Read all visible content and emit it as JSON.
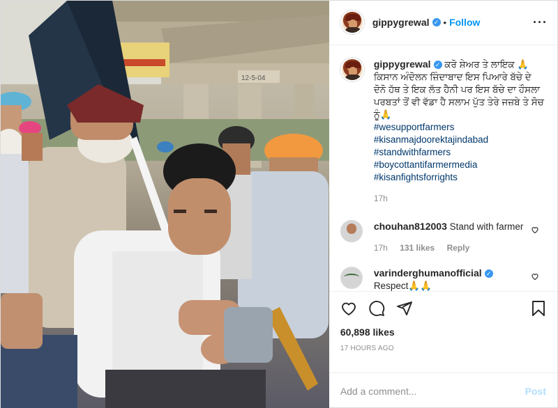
{
  "header": {
    "username": "gippygrewal",
    "follow_label": "Follow",
    "more_icon": "more-options-icon"
  },
  "caption": {
    "username": "gippygrewal",
    "text": "ਕਰੋ ਸ਼ੇਅਰ ਤੇ ਲਾਇਕ 🙏 ਕਿਸਾਨ ਅੰਦੋਲਨ ਜ਼ਿੰਦਾਬਾਦ ਇਸ ਪਿਆਰੇ ਬੱਚੇ ਦੇ ਦੋਨੋ ਹੱਥ ਤੇ ਇਕ ਲੱਤ ਹੈਨੀ ਪਰ ਇਸ ਬੱਚੇ ਦਾ ਹੌਸਲਾ ਪਰਬਤਾਂ ਤੋਂ ਵੀ ਵੱਡਾ ਹੈ ਸਲਾਮ ਪੁੱਤ ਤੇਰੇ ਜਜ਼ਬੇ ਤੇ ਸੋਚ ਨੂੰ🙏",
    "hashtags": [
      "#wesupportfarmers",
      "#kisanmajdoorektajindabad",
      "#standwithfarmers",
      "#boycottantifarmermedia",
      "#kisanfightsforrights"
    ],
    "time": "17h"
  },
  "comments": [
    {
      "username": "chouhan812003",
      "text": "Stand with farmer",
      "time": "17h",
      "likes": "131 likes",
      "reply": "Reply"
    },
    {
      "username": "varinderghumanofficial",
      "text": "Respect🙏🙏"
    }
  ],
  "actions": {
    "likes": "60,898 likes",
    "posted_ago": "17 HOURS AGO"
  },
  "composer": {
    "placeholder": "Add a comment...",
    "post_label": "Post"
  },
  "photo": {
    "sign_text": "12-5-04"
  },
  "colors": {
    "link_blue": "#0095f6",
    "hashtag": "#00376b",
    "muted": "#8e8e8e",
    "post_disabled": "#b2dffc"
  }
}
